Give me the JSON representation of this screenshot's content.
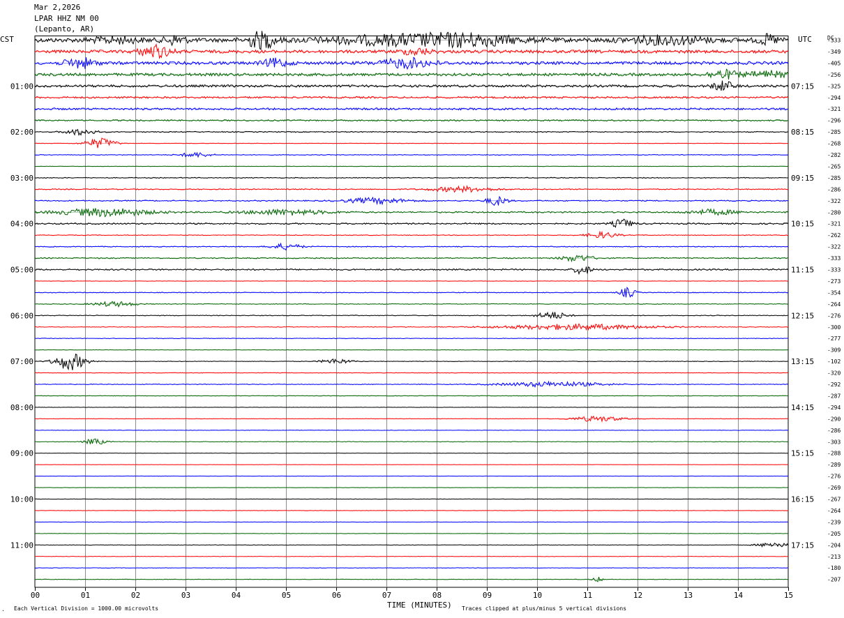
{
  "header": {
    "date": "Mar 2,2026",
    "station": "LPAR HHZ NM 00",
    "location": "(Lepanto, AR)"
  },
  "left_tz": "CST",
  "right_tz": "UTC",
  "dc_label": "DC",
  "footer": {
    "xlabel": "TIME (MINUTES)",
    "scale_note": "Each Vertical Division = 1000.00 microvolts",
    "clip_note": "Traces clipped at plus/minus 5 vertical divisions"
  },
  "colors": {
    "trace_cycle": [
      "#000000",
      "#ff0000",
      "#0000ff",
      "#006400"
    ],
    "grid": "#8c8c8c"
  },
  "chart_data": {
    "type": "helicorder",
    "xlabel": "TIME (MINUTES)",
    "x_ticks": [
      "00",
      "01",
      "02",
      "03",
      "04",
      "05",
      "06",
      "07",
      "08",
      "09",
      "10",
      "11",
      "12",
      "13",
      "14",
      "15"
    ],
    "xlim": [
      0,
      15
    ],
    "lines_per_hour": 4,
    "left_hour_labels": [
      "",
      "01:00",
      "02:00",
      "03:00",
      "04:00",
      "05:00",
      "06:00",
      "07:00",
      "08:00",
      "09:00",
      "10:00",
      "11:00"
    ],
    "right_hour_labels": [
      "",
      "07:15",
      "08:15",
      "09:15",
      "10:15",
      "11:15",
      "12:15",
      "13:15",
      "14:15",
      "15:15",
      "16:15",
      "17:15"
    ],
    "dc_offsets": [
      "333",
      "349",
      "405",
      "256",
      "325",
      "294",
      "321",
      "296",
      "285",
      "268",
      "282",
      "265",
      "285",
      "286",
      "322",
      "280",
      "321",
      "262",
      "322",
      "333",
      "333",
      "273",
      "354",
      "264",
      "276",
      "300",
      "277",
      "309",
      "102",
      "320",
      "292",
      "287",
      "294",
      "290",
      "286",
      "303",
      "288",
      "289",
      "276",
      "269",
      "267",
      "264",
      "239",
      "205",
      "204",
      "213",
      "180",
      "207"
    ],
    "activity": [
      {
        "line": 0,
        "level": 3.0,
        "bursts": [
          [
            1.6,
            0.5,
            1.3
          ],
          [
            2.8,
            0.2,
            2.2
          ],
          [
            4.5,
            0.25,
            4.5
          ],
          [
            7.4,
            1.6,
            2.2
          ],
          [
            8.7,
            0.9,
            1.8
          ],
          [
            12.6,
            0.8,
            1.8
          ],
          [
            14.6,
            0.2,
            2.2
          ]
        ]
      },
      {
        "line": 1,
        "level": 2.2,
        "bursts": [
          [
            2.4,
            0.3,
            3.0
          ],
          [
            7.6,
            0.3,
            1.5
          ]
        ]
      },
      {
        "line": 2,
        "level": 2.2,
        "bursts": [
          [
            0.9,
            0.3,
            2.4
          ],
          [
            4.8,
            0.25,
            2.0
          ],
          [
            7.4,
            0.5,
            2.2
          ]
        ]
      },
      {
        "line": 3,
        "level": 2.0,
        "bursts": [
          [
            13.7,
            0.3,
            2.0
          ],
          [
            14.6,
            0.4,
            1.5
          ]
        ]
      },
      {
        "line": 4,
        "level": 1.7,
        "bursts": [
          [
            13.7,
            0.2,
            2.4
          ]
        ]
      },
      {
        "line": 5,
        "level": 1.3,
        "bursts": []
      },
      {
        "line": 6,
        "level": 1.4,
        "bursts": []
      },
      {
        "line": 7,
        "level": 1.0,
        "bursts": []
      },
      {
        "line": 8,
        "level": 0.7,
        "bursts": [
          [
            0.9,
            0.3,
            1.5
          ]
        ]
      },
      {
        "line": 9,
        "level": 0.3,
        "bursts": [
          [
            1.3,
            0.3,
            2.5
          ]
        ]
      },
      {
        "line": 10,
        "level": 0.5,
        "bursts": [
          [
            3.2,
            0.3,
            1.2
          ]
        ]
      },
      {
        "line": 11,
        "level": 0.3,
        "bursts": []
      },
      {
        "line": 12,
        "level": 0.6,
        "bursts": []
      },
      {
        "line": 13,
        "level": 0.7,
        "bursts": [
          [
            8.5,
            0.6,
            1.3
          ]
        ]
      },
      {
        "line": 14,
        "level": 0.8,
        "bursts": [
          [
            6.8,
            0.6,
            1.4
          ],
          [
            9.2,
            0.2,
            2.2
          ]
        ]
      },
      {
        "line": 15,
        "level": 1.0,
        "bursts": [
          [
            1.4,
            0.9,
            1.9
          ],
          [
            5.0,
            0.8,
            1.3
          ],
          [
            13.5,
            0.5,
            1.2
          ]
        ]
      },
      {
        "line": 16,
        "level": 1.0,
        "bursts": [
          [
            11.7,
            0.2,
            2.2
          ]
        ]
      },
      {
        "line": 17,
        "level": 0.5,
        "bursts": [
          [
            11.3,
            0.3,
            1.5
          ]
        ]
      },
      {
        "line": 18,
        "level": 0.6,
        "bursts": [
          [
            5.0,
            0.3,
            1.5
          ]
        ]
      },
      {
        "line": 19,
        "level": 0.8,
        "bursts": [
          [
            10.8,
            0.3,
            1.6
          ]
        ]
      },
      {
        "line": 20,
        "level": 1.0,
        "bursts": [
          [
            10.9,
            0.15,
            2.6
          ]
        ]
      },
      {
        "line": 21,
        "level": 0.3,
        "bursts": []
      },
      {
        "line": 22,
        "level": 0.5,
        "bursts": [
          [
            11.8,
            0.15,
            2.5
          ]
        ]
      },
      {
        "line": 23,
        "level": 0.5,
        "bursts": [
          [
            1.6,
            0.4,
            1.2
          ]
        ]
      },
      {
        "line": 24,
        "level": 0.5,
        "bursts": [
          [
            10.3,
            0.3,
            1.8
          ]
        ]
      },
      {
        "line": 25,
        "level": 0.4,
        "bursts": [
          [
            10.8,
            1.5,
            1.4
          ]
        ]
      },
      {
        "line": 26,
        "level": 0.4,
        "bursts": []
      },
      {
        "line": 27,
        "level": 0.3,
        "bursts": []
      },
      {
        "line": 28,
        "level": 0.4,
        "bursts": [
          [
            0.7,
            0.3,
            4.2
          ],
          [
            6.0,
            0.3,
            1.2
          ]
        ]
      },
      {
        "line": 29,
        "level": 0.4,
        "bursts": []
      },
      {
        "line": 30,
        "level": 0.5,
        "bursts": [
          [
            10.3,
            1.0,
            1.2
          ]
        ]
      },
      {
        "line": 31,
        "level": 0.4,
        "bursts": []
      },
      {
        "line": 32,
        "level": 0.25,
        "bursts": []
      },
      {
        "line": 33,
        "level": 0.3,
        "bursts": [
          [
            11.2,
            0.5,
            1.3
          ]
        ]
      },
      {
        "line": 34,
        "level": 0.3,
        "bursts": []
      },
      {
        "line": 35,
        "level": 0.4,
        "bursts": [
          [
            1.2,
            0.2,
            1.5
          ]
        ]
      },
      {
        "line": 36,
        "level": 0.25,
        "bursts": []
      },
      {
        "line": 37,
        "level": 0.2,
        "bursts": []
      },
      {
        "line": 38,
        "level": 0.2,
        "bursts": []
      },
      {
        "line": 39,
        "level": 0.2,
        "bursts": []
      },
      {
        "line": 40,
        "level": 0.25,
        "bursts": []
      },
      {
        "line": 41,
        "level": 0.25,
        "bursts": []
      },
      {
        "line": 42,
        "level": 0.25,
        "bursts": []
      },
      {
        "line": 43,
        "level": 0.25,
        "bursts": []
      },
      {
        "line": 44,
        "level": 0.3,
        "bursts": [
          [
            14.7,
            0.3,
            1.3
          ]
        ]
      },
      {
        "line": 45,
        "level": 0.3,
        "bursts": []
      },
      {
        "line": 46,
        "level": 0.3,
        "bursts": []
      },
      {
        "line": 47,
        "level": 0.35,
        "bursts": [
          [
            11.2,
            0.1,
            1.2
          ]
        ]
      }
    ]
  }
}
